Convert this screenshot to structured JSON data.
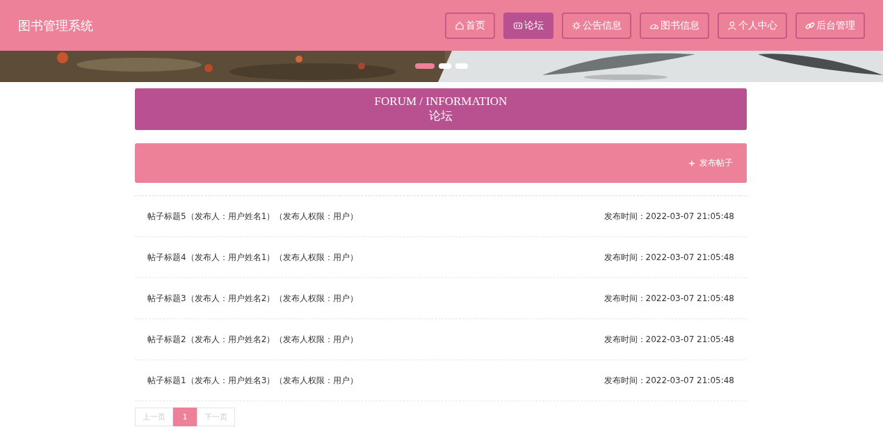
{
  "header": {
    "title": "图书管理系统",
    "nav": [
      {
        "label": "首页",
        "selected": false
      },
      {
        "label": "论坛",
        "selected": true
      },
      {
        "label": "公告信息",
        "selected": false
      },
      {
        "label": "图书信息",
        "selected": false
      },
      {
        "label": "个人中心",
        "selected": false
      },
      {
        "label": "后台管理",
        "selected": false
      }
    ]
  },
  "banner": {
    "dots": [
      {
        "selected": true
      },
      {
        "selected": false
      },
      {
        "selected": false
      }
    ]
  },
  "section": {
    "title_en": "FORUM / INFORMATION",
    "title_cn": "论坛"
  },
  "toolbar": {
    "publish_button": "发布帖子"
  },
  "posts": [
    {
      "title": "帖子标题5（发布人：用户姓名1）（发布人权限：用户）",
      "time": "发布时间：2022-03-07 21:05:48"
    },
    {
      "title": "帖子标题4（发布人：用户姓名1）（发布人权限：用户）",
      "time": "发布时间：2022-03-07 21:05:48"
    },
    {
      "title": "帖子标题3（发布人：用户姓名2）（发布人权限：用户）",
      "time": "发布时间：2022-03-07 21:05:48"
    },
    {
      "title": "帖子标题2（发布人：用户姓名2）（发布人权限：用户）",
      "time": "发布时间：2022-03-07 21:05:48"
    },
    {
      "title": "帖子标题1（发布人：用户姓名3）（发布人权限：用户）",
      "time": "发布时间：2022-03-07 21:05:48"
    }
  ],
  "pagination": {
    "prev": {
      "label": "上一页",
      "disabled": true
    },
    "pages": [
      {
        "label": "1",
        "selected": true
      }
    ],
    "next": {
      "label": "下一页",
      "disabled": true
    }
  }
}
